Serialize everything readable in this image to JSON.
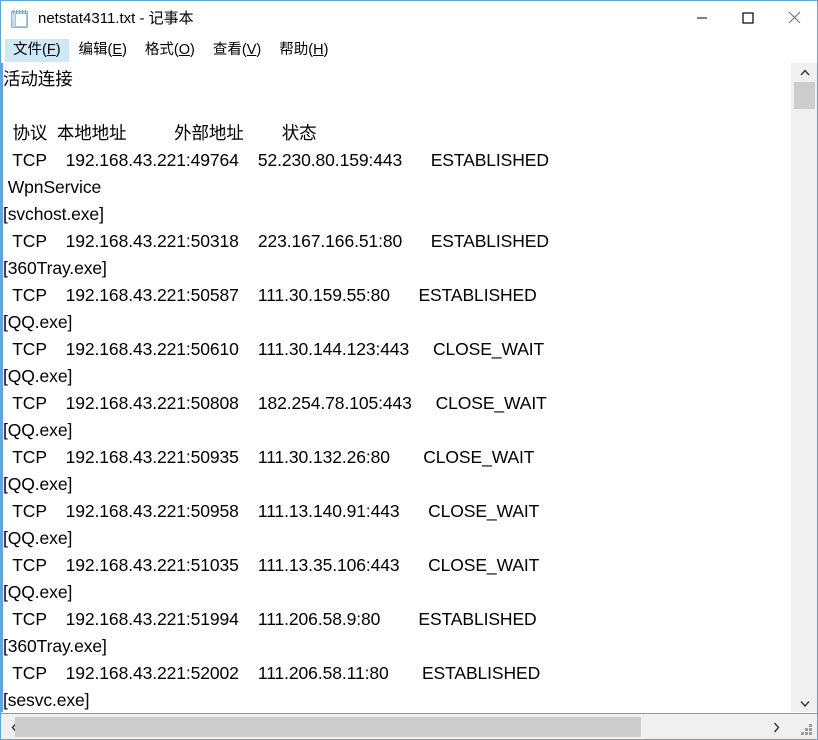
{
  "window": {
    "title": "netstat4311.txt - 记事本",
    "icon": "notepad-icon",
    "border_color": "#5aa7dd",
    "controls": {
      "minimize": "minimize-icon",
      "maximize": "maximize-icon",
      "close": "close-icon"
    }
  },
  "menubar": {
    "items": [
      {
        "label": "文件(F)",
        "text": "文件(",
        "accel": "F",
        "tail": ")",
        "active": true
      },
      {
        "label": "编辑(E)",
        "text": "编辑(",
        "accel": "E",
        "tail": ")",
        "active": false
      },
      {
        "label": "格式(O)",
        "text": "格式(",
        "accel": "O",
        "tail": ")",
        "active": false
      },
      {
        "label": "查看(V)",
        "text": "查看(",
        "accel": "V",
        "tail": ")",
        "active": false
      },
      {
        "label": "帮助(H)",
        "text": "帮助(",
        "accel": "H",
        "tail": ")",
        "active": false
      }
    ]
  },
  "document": {
    "lines": [
      "活动连接",
      "",
      "  协议  本地地址          外部地址        状态",
      "  TCP    192.168.43.221:49764    52.230.80.159:443      ESTABLISHED",
      " WpnService",
      "[svchost.exe]",
      "  TCP    192.168.43.221:50318    223.167.166.51:80      ESTABLISHED",
      "[360Tray.exe]",
      "  TCP    192.168.43.221:50587    111.30.159.55:80      ESTABLISHED",
      "[QQ.exe]",
      "  TCP    192.168.43.221:50610    111.30.144.123:443     CLOSE_WAIT",
      "[QQ.exe]",
      "  TCP    192.168.43.221:50808    182.254.78.105:443     CLOSE_WAIT",
      "[QQ.exe]",
      "  TCP    192.168.43.221:50935    111.30.132.26:80       CLOSE_WAIT",
      "[QQ.exe]",
      "  TCP    192.168.43.221:50958    111.13.140.91:443      CLOSE_WAIT",
      "[QQ.exe]",
      "  TCP    192.168.43.221:51035    111.13.35.106:443      CLOSE_WAIT",
      "[QQ.exe]",
      "  TCP    192.168.43.221:51994    111.206.58.9:80        ESTABLISHED",
      "[360Tray.exe]",
      "  TCP    192.168.43.221:52002    111.206.58.11:80       ESTABLISHED",
      "[sesvc.exe]"
    ]
  },
  "scrollbars": {
    "vertical": {
      "up_arrow": "chevron-up-icon",
      "down_arrow": "chevron-down-icon",
      "thumb_color": "#cdcdcd",
      "track_color": "#f0f0f0"
    },
    "horizontal": {
      "left_arrow": "chevron-left-icon",
      "right_arrow": "chevron-right-icon",
      "thumb_color": "#cdcdcd",
      "track_color": "#f0f0f0"
    },
    "resize_grip": "resize-grip-icon"
  }
}
